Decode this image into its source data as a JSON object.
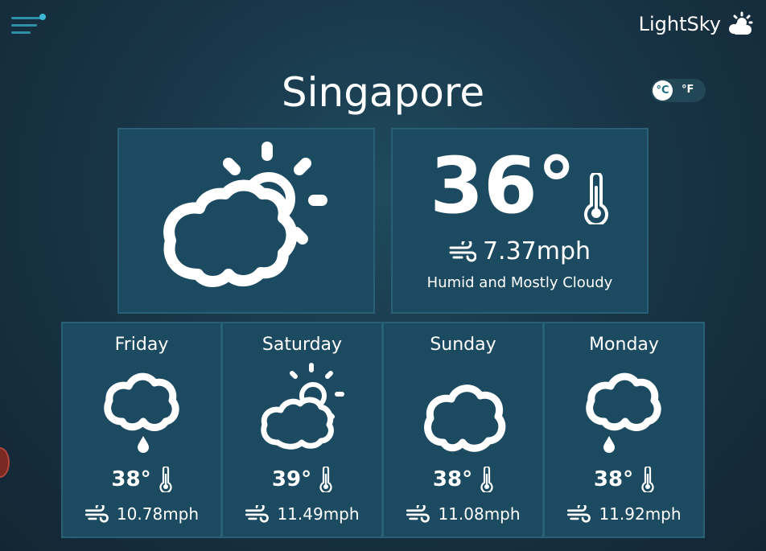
{
  "app": {
    "brand": "LightSky",
    "brand_icon": "sun-cloud-icon",
    "menu_icon": "hamburger-menu-icon"
  },
  "units": {
    "celsius": "°C",
    "fahrenheit": "°F",
    "selected": "celsius"
  },
  "current": {
    "city": "Singapore",
    "condition_icon": "partly-cloudy-icon",
    "temperature": "36°",
    "wind": "7.37mph",
    "description": "Humid and Mostly Cloudy"
  },
  "forecast": [
    {
      "day": "Friday",
      "icon": "rain-cloud-icon",
      "temperature": "38°",
      "wind": "10.78mph"
    },
    {
      "day": "Saturday",
      "icon": "partly-cloudy-icon",
      "temperature": "39°",
      "wind": "11.49mph"
    },
    {
      "day": "Sunday",
      "icon": "cloud-icon",
      "temperature": "38°",
      "wind": "11.08mph"
    },
    {
      "day": "Monday",
      "icon": "rain-cloud-icon",
      "temperature": "38°",
      "wind": "11.92mph"
    }
  ],
  "colors": {
    "panel": "#1c4b61",
    "panel_border": "#2a6076",
    "accent": "#3bb6d6",
    "text": "#ffffff"
  }
}
